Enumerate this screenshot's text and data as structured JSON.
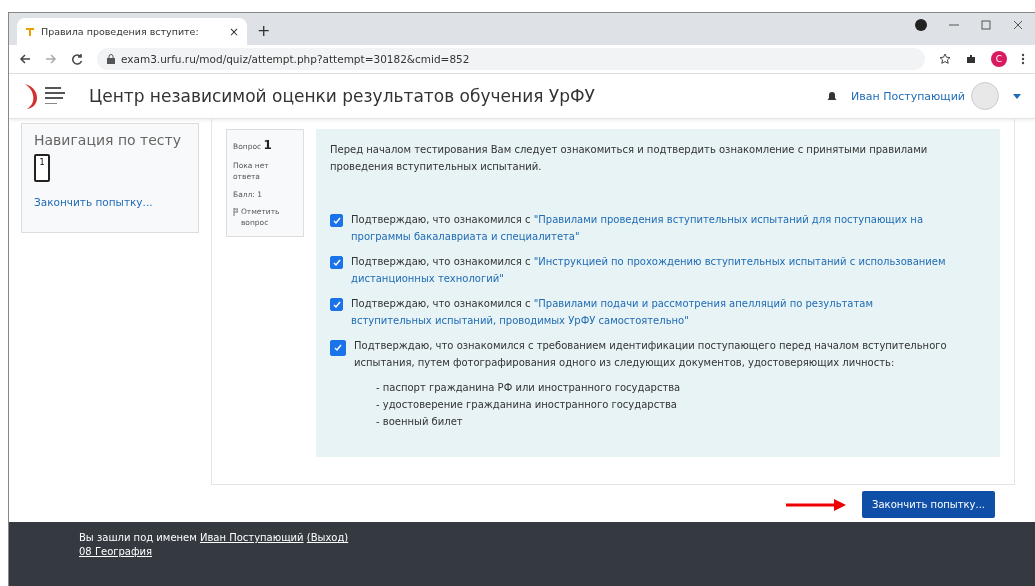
{
  "browser": {
    "tab_title": "Правила проведения вступите:",
    "tab_close": "×",
    "new_tab": "+",
    "url": "exam3.urfu.ru/mod/quiz/attempt.php?attempt=30182&cmid=852",
    "profile_letter": "C"
  },
  "header": {
    "site_title": "Центр независимой оценки результатов обучения УрФУ",
    "user_name": "Иван Поступающий"
  },
  "navigation": {
    "title": "Навигация по тесту",
    "questions": [
      {
        "number": "1",
        "selected": true
      }
    ],
    "finish_link": "Закончить попытку..."
  },
  "question_info": {
    "label": "Вопрос",
    "number": "1",
    "status": "Пока нет ответа",
    "score": "Балл: 1",
    "flag": "Отметить вопрос"
  },
  "intro": "Перед началом тестирования Вам следует ознакомиться и подтвердить ознакомление с принятыми правилами проведения вступительных испытаний.",
  "confirmations": [
    {
      "kind": "link",
      "text": "Подтверждаю, что ознакомился с ",
      "link_lines": [
        "\"Правилами проведения вступительных испытаний для поступающих на",
        "программы бакалавриата и специалитета\""
      ],
      "checked": true
    },
    {
      "kind": "link",
      "text": "Подтверждаю, что ознакомился с ",
      "link_lines": [
        "\"Инструкцией по прохождению вступительных испытаний с использованием",
        "дистанционных технологий\""
      ],
      "checked": true
    },
    {
      "kind": "link",
      "text": "Подтверждаю, что ознакомился с ",
      "link_lines": [
        "\"Правилами подачи и рассмотрения апелляций по результатам",
        "вступительных испытаний, проводимых УрФУ самостоятельно\""
      ],
      "checked": true
    },
    {
      "kind": "plain",
      "text": "Подтверждаю, что ознакомился с требованием идентификации поступающего перед началом вступительного испытания, путем фотографирования одного из следующих документов, удостоверяющих личность:",
      "checked": true,
      "documents": [
        "- паспорт гражданина РФ или иностранного государства",
        "- удостоверение гражданина иностранного государства",
        "- военный билет"
      ]
    }
  ],
  "finish_button": "Закончить попытку...",
  "footer": {
    "logged_in_text": "Вы зашли под именем ",
    "user_link": "Иван Поступающий",
    "logout_link": "(Выход)",
    "course_link": "08 География"
  }
}
